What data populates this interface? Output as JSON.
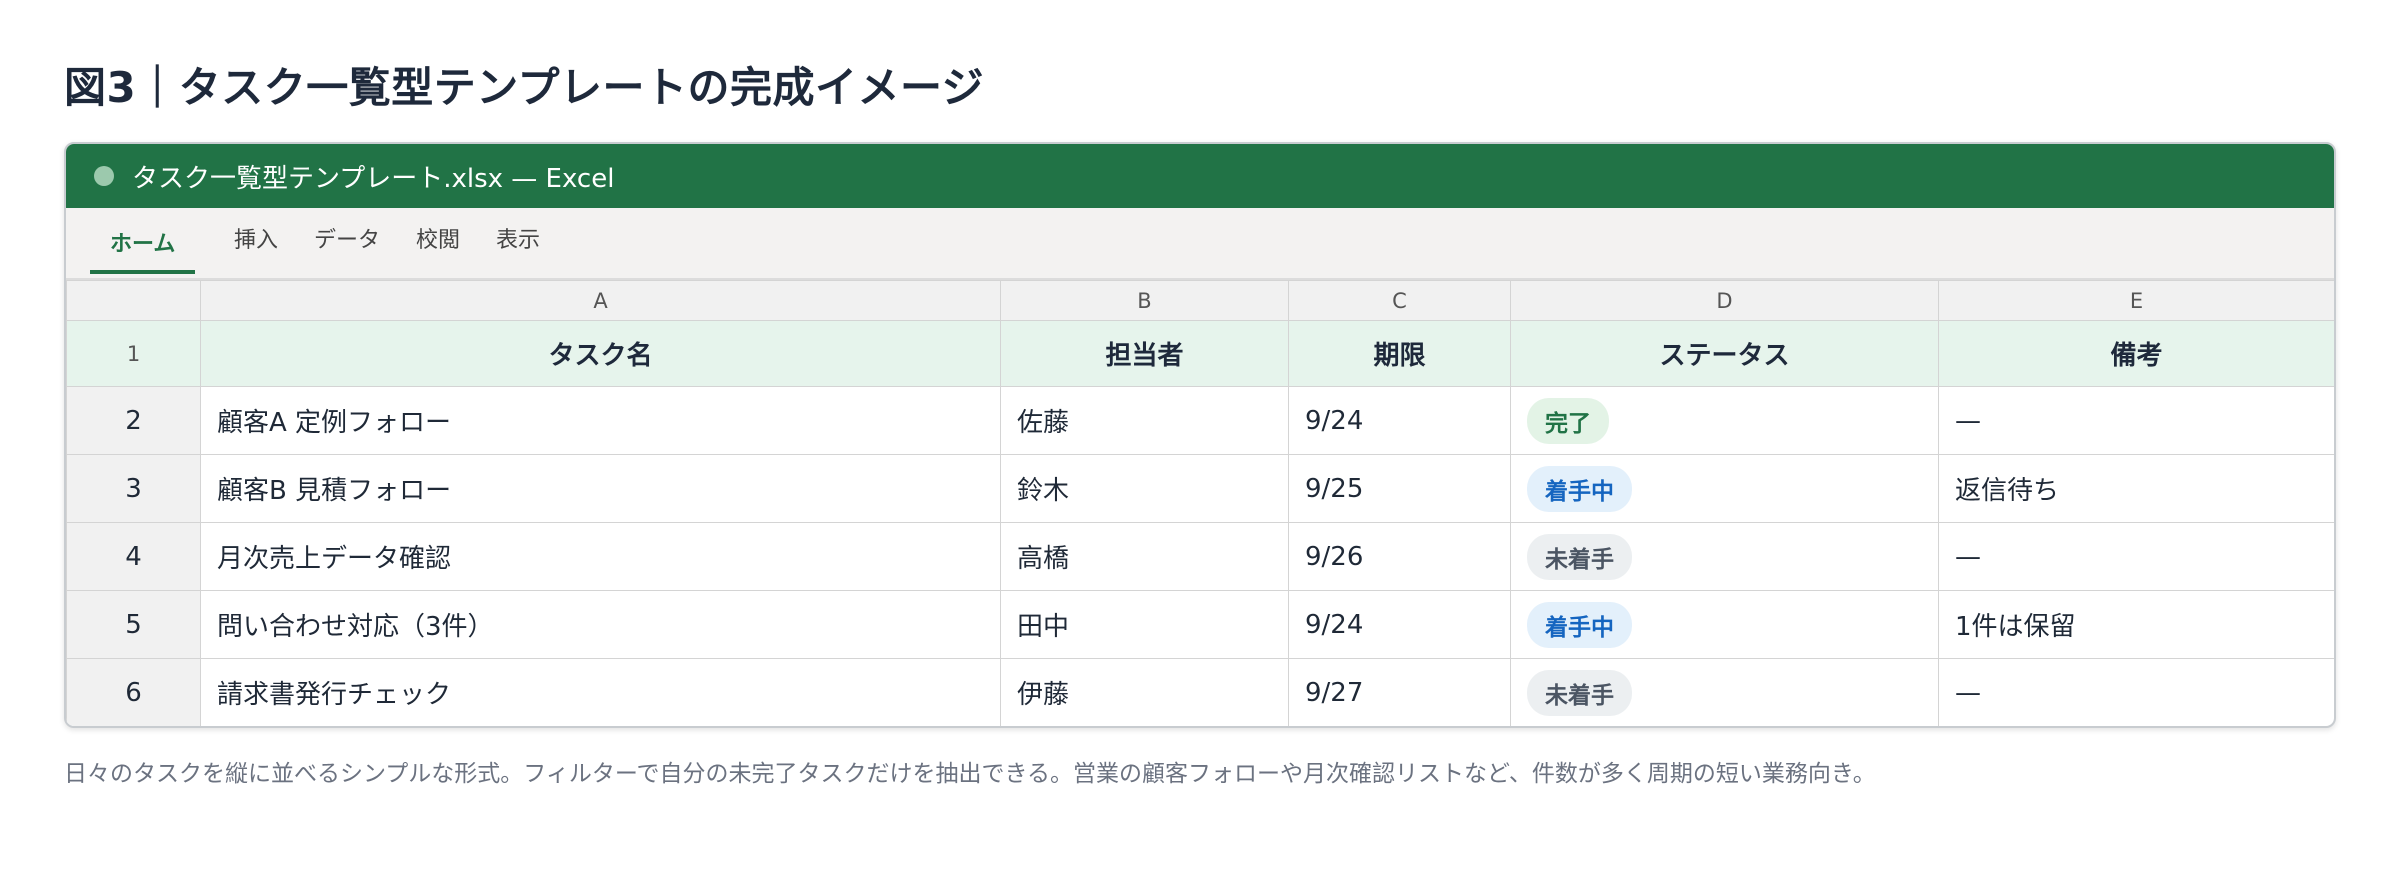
{
  "figure_title": "図3｜タスク一覧型テンプレートの完成イメージ",
  "window": {
    "title": "タスク一覧型テンプレート.xlsx — Excel",
    "accent_color": "#217346"
  },
  "ribbon": {
    "tabs": [
      {
        "label": "ホーム",
        "active": true
      },
      {
        "label": "挿入",
        "active": false
      },
      {
        "label": "データ",
        "active": false
      },
      {
        "label": "校閲",
        "active": false
      },
      {
        "label": "表示",
        "active": false
      }
    ]
  },
  "sheet": {
    "column_letters": [
      "A",
      "B",
      "C",
      "D",
      "E"
    ],
    "row_numbers": [
      "1",
      "2",
      "3",
      "4",
      "5",
      "6"
    ],
    "headers": [
      "タスク名",
      "担当者",
      "期限",
      "ステータス",
      "備考"
    ],
    "rows": [
      {
        "task": "顧客A 定例フォロー",
        "owner": "佐藤",
        "due": "9/24",
        "status": "完了",
        "status_type": "done",
        "note": "—"
      },
      {
        "task": "顧客B 見積フォロー",
        "owner": "鈴木",
        "due": "9/25",
        "status": "着手中",
        "status_type": "progress",
        "note": "返信待ち"
      },
      {
        "task": "月次売上データ確認",
        "owner": "高橋",
        "due": "9/26",
        "status": "未着手",
        "status_type": "todo",
        "note": "—"
      },
      {
        "task": "問い合わせ対応（3件）",
        "owner": "田中",
        "due": "9/24",
        "status": "着手中",
        "status_type": "progress",
        "note": "1件は保留"
      },
      {
        "task": "請求書発行チェック",
        "owner": "伊藤",
        "due": "9/27",
        "status": "未着手",
        "status_type": "todo",
        "note": "—"
      }
    ],
    "status_colors": {
      "done": {
        "bg": "#e3f3e6",
        "fg": "#217346"
      },
      "progress": {
        "bg": "#e3f0fb",
        "fg": "#1565c0"
      },
      "todo": {
        "bg": "#eceff1",
        "fg": "#4b5563"
      }
    }
  },
  "caption": "日々のタスクを縦に並べるシンプルな形式。フィルターで自分の未完了タスクだけを抽出できる。営業の顧客フォローや月次確認リストなど、件数が多く周期の短い業務向き。"
}
